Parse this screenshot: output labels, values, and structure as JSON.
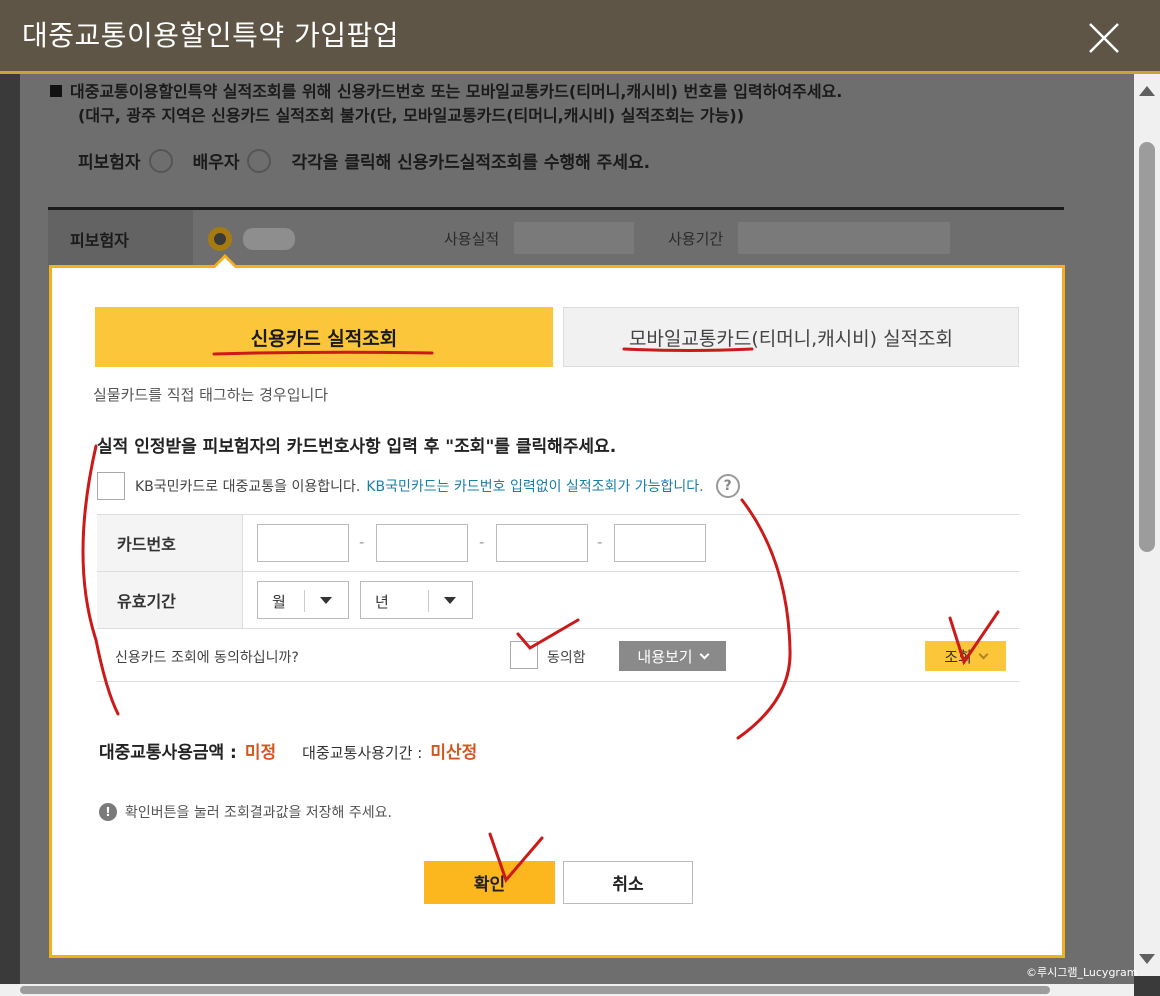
{
  "window": {
    "title": "대중교통이용할인특약 가입팝업",
    "close_icon": "close-icon"
  },
  "background": {
    "notice_line1": "대중교통이용할인특약 실적조회를 위해 신용카드번호 또는 모바일교통카드(티머니,캐시비) 번호를 입력하여주세요.",
    "notice_line2": "(대구, 광주 지역은 신용카드 실적조회 불가(단, 모바일교통카드(티머니,캐시비) 실적조회는 가능))",
    "radio_insured": "피보험자",
    "radio_spouse": "배우자",
    "radio_hint": "각각을 클릭해 신용카드실적조회를 수행해 주세요.",
    "row_header": "피보험자",
    "usage_label": "사용실적",
    "period_label": "사용기간"
  },
  "popup": {
    "tabs": [
      {
        "label": "신용카드 실적조회",
        "active": true
      },
      {
        "label": "모바일교통카드(티머니,캐시비) 실적조회",
        "active": false
      }
    ],
    "tab_desc": "실물카드를 직접 태그하는 경우입니다",
    "instruction": "실적 인정받을 피보험자의 카드번호사항 입력 후 \"조회\"를 클릭해주세요.",
    "kb_checkbox_label": "KB국민카드로 대중교통을 이용합니다.",
    "kb_link": "KB국민카드는 카드번호 입력없이 실적조회가 가능합니다.",
    "help_glyph": "?",
    "card_number_label": "카드번호",
    "card_dash": "-",
    "expiry_label": "유효기간",
    "month_select": "월",
    "year_select": "년",
    "agree_question": "신용카드 조회에 동의하십니까?",
    "agree_label": "동의함",
    "view_button": "내용보기",
    "query_button": "조회",
    "amount_label": "대중교통사용금액 :",
    "amount_value": "미정",
    "period_label": "대중교통사용기간 :",
    "period_value": "미산정",
    "note_glyph": "!",
    "note": "확인버튼을 눌러 조회결과값을 저장해 주세요.",
    "ok_button": "확인",
    "cancel_button": "취소"
  },
  "colors": {
    "accent": "#fcc63a",
    "value_orange": "#d4561e",
    "link_blue": "#1a7ea8",
    "annotation_red": "#cc1a1a"
  },
  "watermark": "©루시그램_Lucygram"
}
